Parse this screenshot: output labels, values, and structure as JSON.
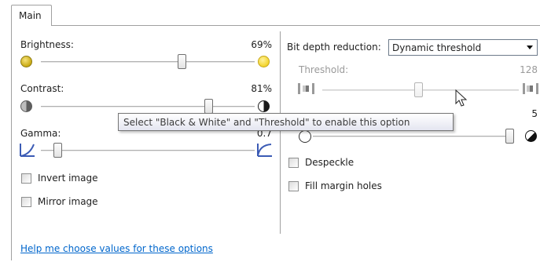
{
  "tab": {
    "label": "Main"
  },
  "brightness": {
    "label": "Brightness:",
    "value": "69%",
    "level": 69
  },
  "contrast": {
    "label": "Contrast:",
    "value": "81%",
    "level": 81
  },
  "gamma": {
    "label": "Gamma:",
    "value": "0.7"
  },
  "invert": {
    "label": "Invert image",
    "checked": false
  },
  "mirror": {
    "label": "Mirror image",
    "checked": false
  },
  "bit_depth": {
    "label": "Bit depth reduction:",
    "selected": "Dynamic threshold"
  },
  "threshold": {
    "label": "Threshold:",
    "value": "128"
  },
  "noise": {
    "value": "5"
  },
  "despeckle": {
    "label": "Despeckle",
    "checked": false
  },
  "fill_holes": {
    "label": "Fill margin holes",
    "checked": false
  },
  "tooltip": {
    "text": "Select \"Black & White\" and \"Threshold\" to enable this option"
  },
  "help_link": {
    "text": "Help me choose values for these options"
  },
  "colors": {
    "link": "#0066cc",
    "disabled_text": "#9a9a9a"
  }
}
